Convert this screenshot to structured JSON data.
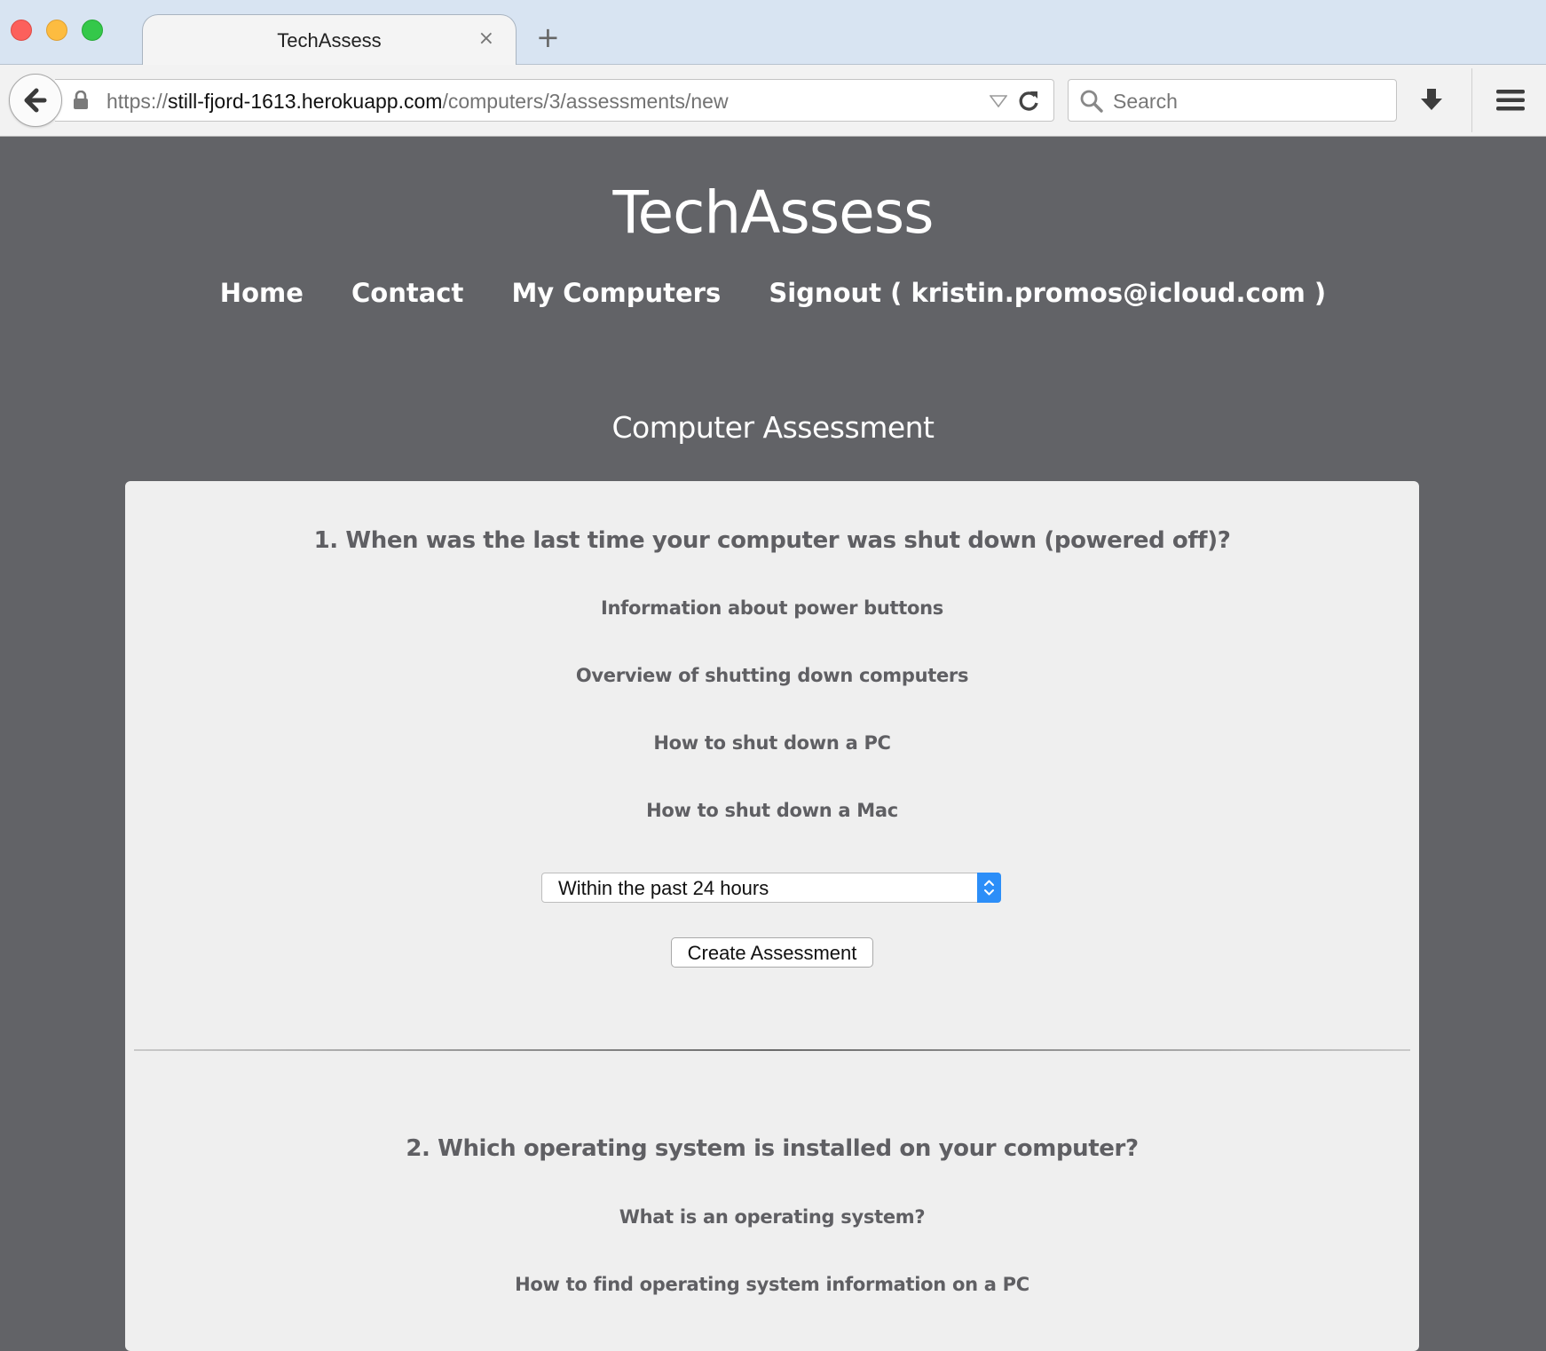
{
  "browser": {
    "tab_title": "TechAssess",
    "tab_close": "×",
    "new_tab": "+",
    "url_scheme": "https://",
    "url_host": "still-fjord-1613.herokuapp.com",
    "url_path": "/computers/3/assessments/new",
    "search_placeholder": "Search"
  },
  "site": {
    "title": "TechAssess",
    "nav": [
      "Home",
      "Contact",
      "My Computers",
      "Signout ( kristin.promos@icloud.com )"
    ]
  },
  "page": {
    "heading": "Computer Assessment",
    "questions": [
      {
        "question": "1. When was the last time your computer was shut down (powered off)?",
        "resources": [
          "Information about power buttons",
          "Overview of shutting down computers",
          "How to shut down a PC",
          "How to shut down a Mac"
        ],
        "selected_option": "Within the past 24 hours",
        "submit_label": "Create Assessment"
      },
      {
        "question": "2. Which operating system is installed on your computer?",
        "resources": [
          "What is an operating system?",
          "How to find operating system information on a PC"
        ]
      }
    ]
  },
  "colors": {
    "page_bg": "#626367",
    "panel_bg": "#efefef",
    "text_muted": "#5f5f63",
    "select_accent": "#2c8ef8"
  }
}
